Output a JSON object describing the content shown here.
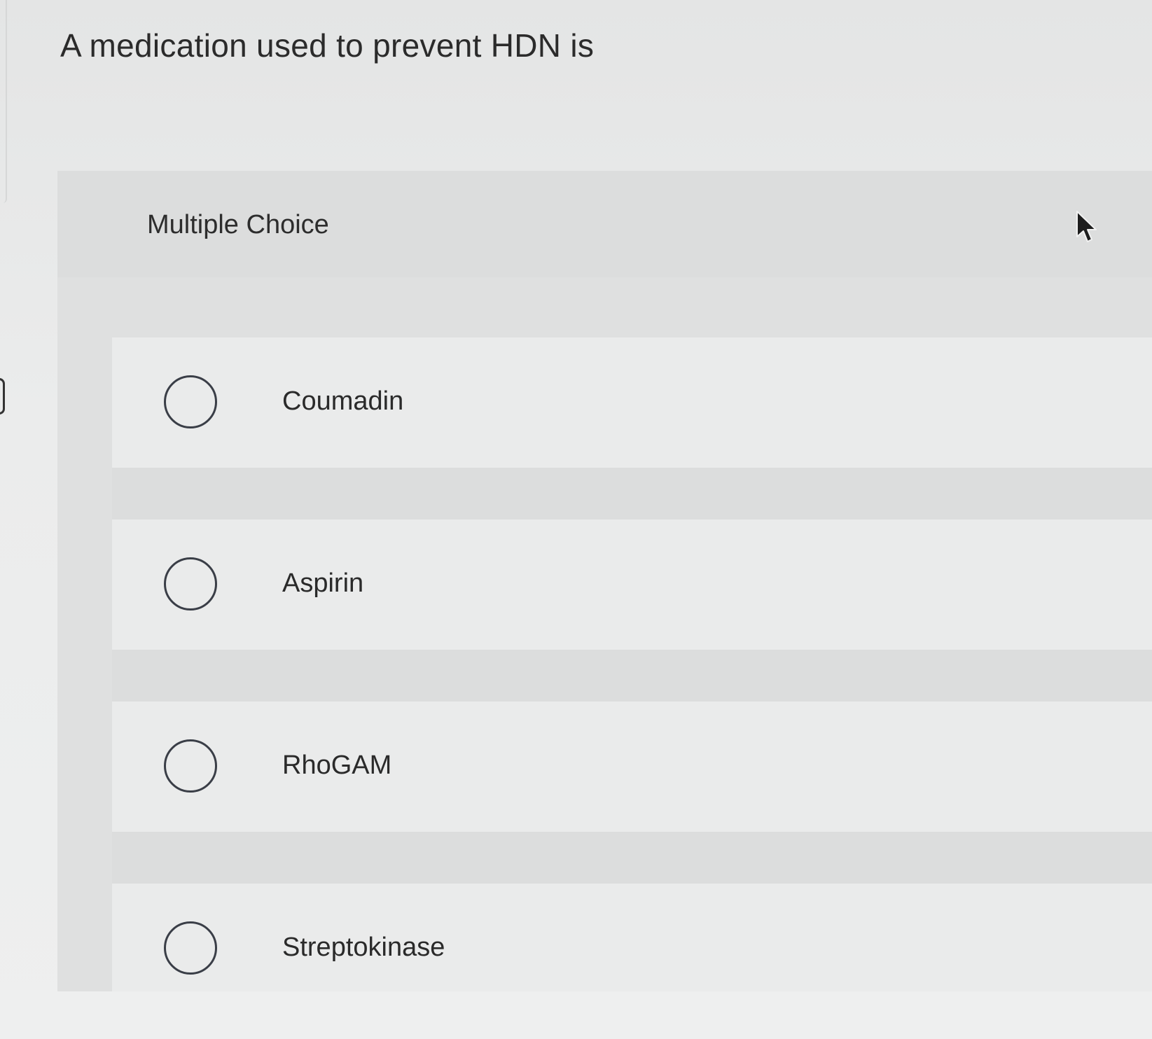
{
  "question": {
    "text": "A medication used to prevent HDN is"
  },
  "panel": {
    "label": "Multiple Choice"
  },
  "options": [
    {
      "label": "Coumadin",
      "selected": false
    },
    {
      "label": "Aspirin",
      "selected": false
    },
    {
      "label": "RhoGAM",
      "selected": false
    },
    {
      "label": "Streptokinase",
      "selected": false
    }
  ],
  "icons": {
    "cursor": "mouse-pointer-icon",
    "radio": "radio-unchecked-icon"
  }
}
